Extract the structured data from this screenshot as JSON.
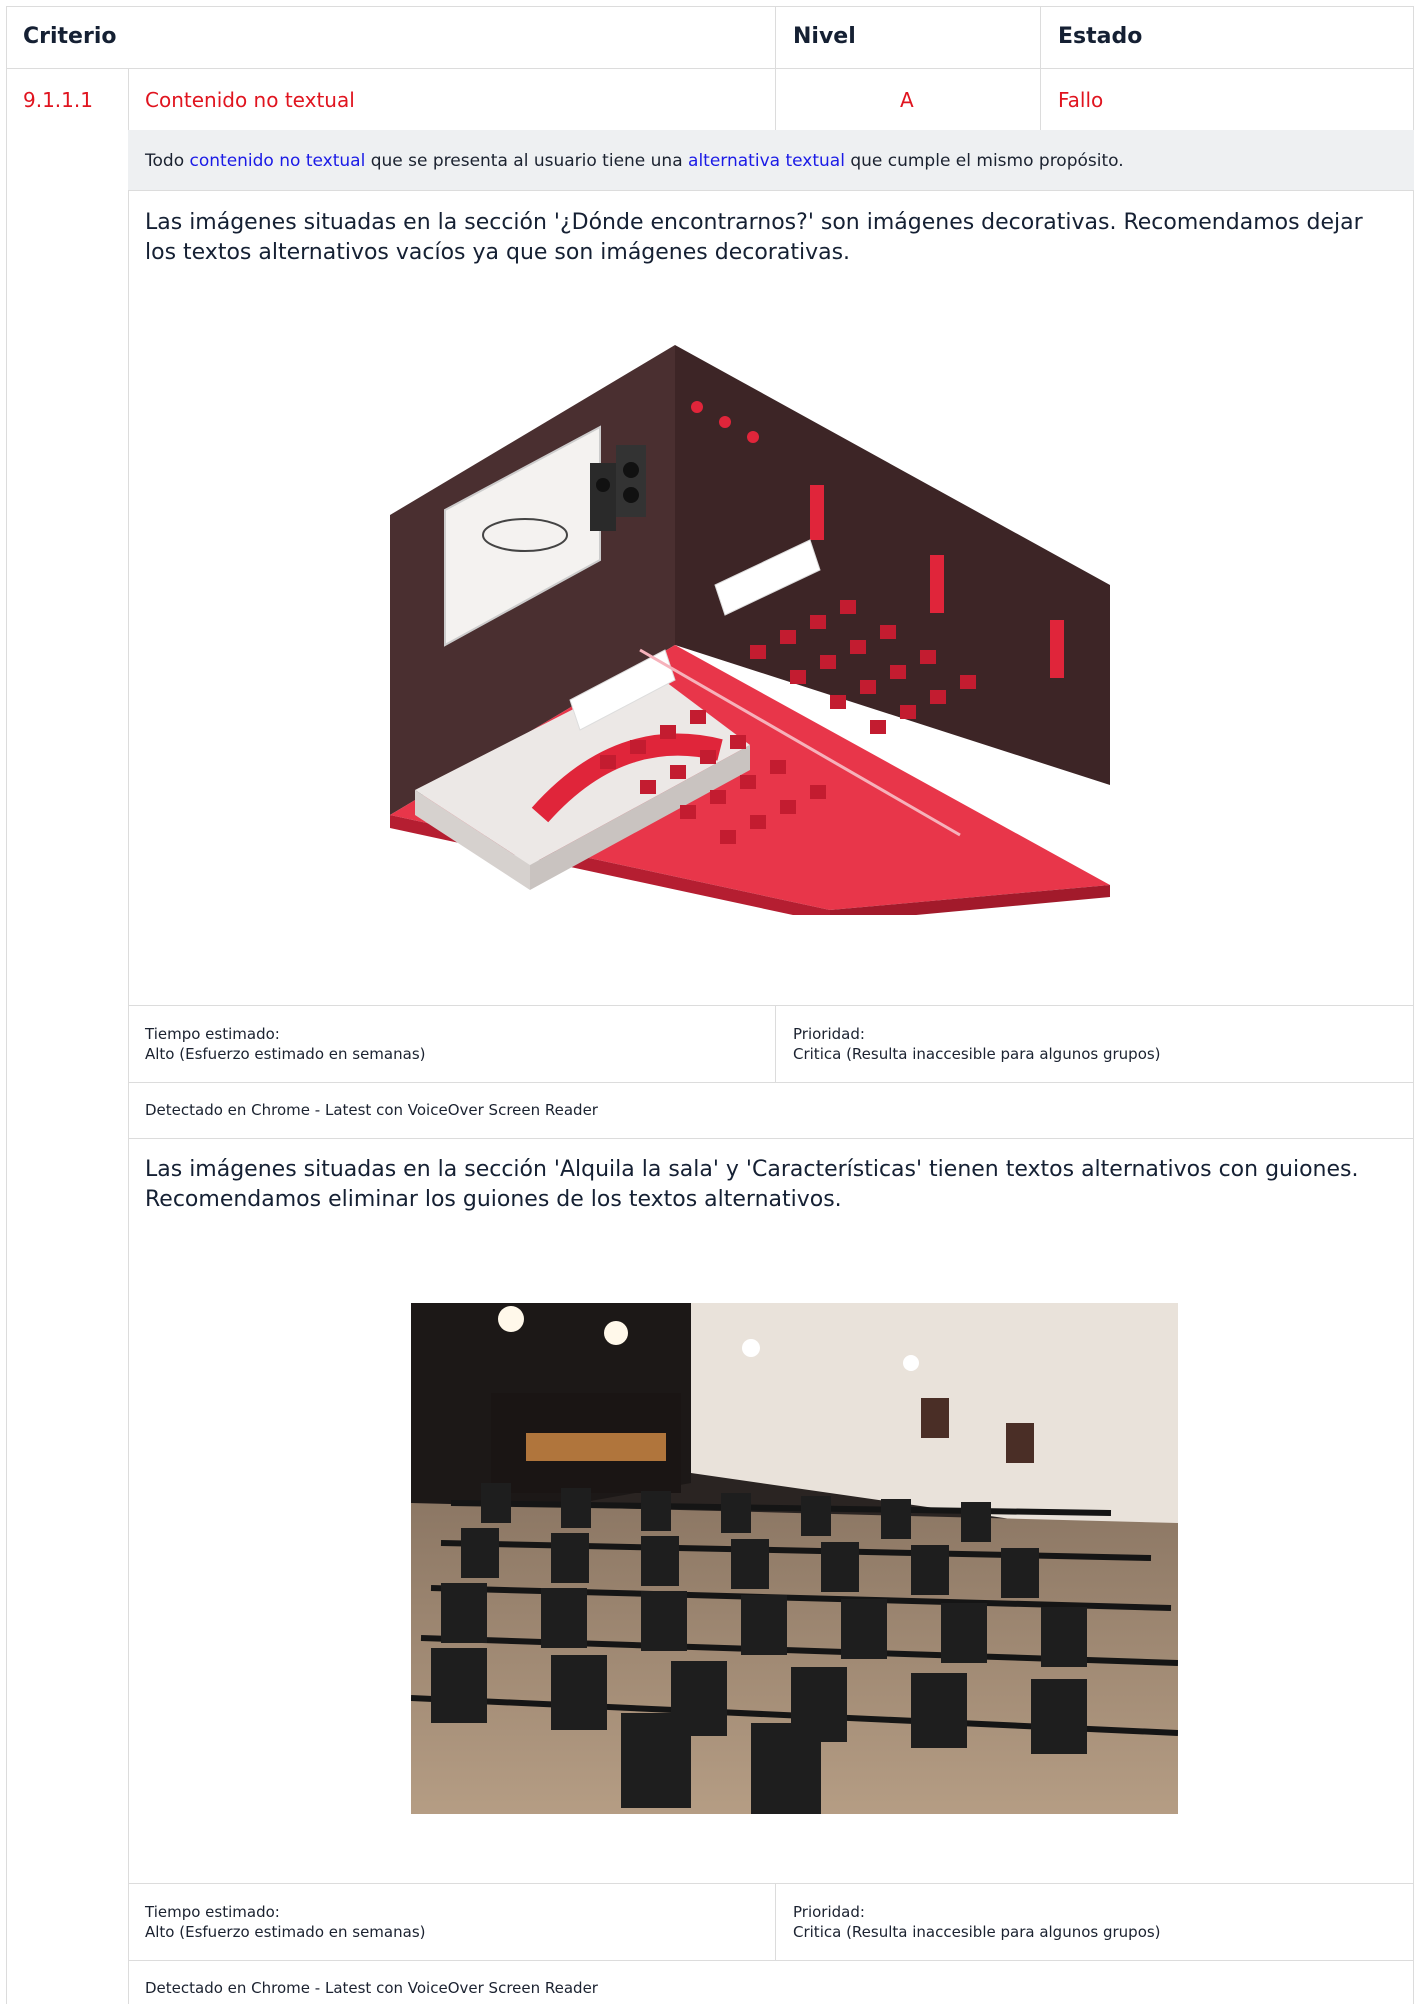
{
  "header": {
    "criterio": "Criterio",
    "nivel": "Nivel",
    "estado": "Estado"
  },
  "criterion": {
    "id": "9.1.1.1",
    "name": "Contenido no textual",
    "level": "A",
    "status": "Fallo"
  },
  "description": {
    "pre": "Todo ",
    "link1": "contenido no textual",
    "mid": " que se presenta al usuario tiene una ",
    "link2": "alternativa textual",
    "post": " que cumple el mismo propósito."
  },
  "issues": [
    {
      "text": "Las imágenes situadas en la sección '¿Dónde encontrarnos?' son imágenes decorativas. Recomendamos dejar los textos alternativos vacíos ya que son imágenes decorativas.",
      "image_icon": "isometric-conference-room-illustration",
      "time_label": "Tiempo estimado:",
      "time_value": "Alto (Esfuerzo estimado en semanas)",
      "priority_label": "Prioridad:",
      "priority_value": "Critica (Resulta inaccesible para algunos grupos)",
      "detected": "Detectado en Chrome - Latest con VoiceOver Screen Reader"
    },
    {
      "text": "Las imágenes situadas en la sección 'Alquila la sala' y 'Características' tienen textos alternativos con guiones. Recomendamos eliminar los guiones de los textos alternativos.",
      "image_icon": "event-hall-chairs-photo",
      "time_label": "Tiempo estimado:",
      "time_value": "Alto (Esfuerzo estimado en semanas)",
      "priority_label": "Prioridad:",
      "priority_value": "Critica (Resulta inaccesible para algunos grupos)",
      "detected": "Detectado en Chrome - Latest con VoiceOver Screen Reader"
    }
  ],
  "colors": {
    "fail": "#e0141f",
    "link": "#1a1ae6",
    "row_bg": "#eef0f2",
    "border": "#dcdcdc"
  }
}
